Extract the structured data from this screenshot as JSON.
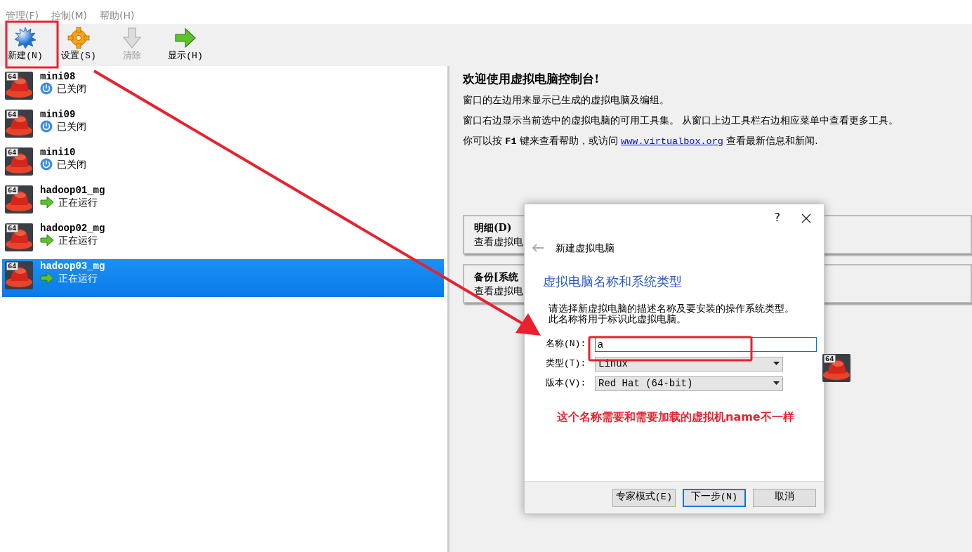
{
  "menu": [
    {
      "label": "管理(F)"
    },
    {
      "label": "控制(M)"
    },
    {
      "label": "帮助(H)"
    }
  ],
  "toolbar": [
    {
      "label": "新建(N)",
      "kind": "new",
      "disabled": false
    },
    {
      "label": "设置(S)",
      "kind": "settings",
      "disabled": false
    },
    {
      "label": "清除",
      "kind": "discard",
      "disabled": true
    },
    {
      "label": "显示(H)",
      "kind": "show",
      "disabled": false
    }
  ],
  "vms": [
    {
      "name": "mini08",
      "arch": "64",
      "status": "已关闭",
      "kind": "off",
      "selected": false
    },
    {
      "name": "mini09",
      "arch": "64",
      "status": "已关闭",
      "kind": "off",
      "selected": false
    },
    {
      "name": "mini10",
      "arch": "64",
      "status": "已关闭",
      "kind": "off",
      "selected": false
    },
    {
      "name": "hadoop01_mg",
      "arch": "64",
      "status": "正在运行",
      "kind": "running",
      "selected": false
    },
    {
      "name": "hadoop02_mg",
      "arch": "64",
      "status": "正在运行",
      "kind": "running",
      "selected": false
    },
    {
      "name": "hadoop03_mg",
      "arch": "64",
      "status": "正在运行",
      "kind": "running",
      "selected": true
    }
  ],
  "welcome": {
    "title": "欢迎使用虚拟电脑控制台!",
    "lines": [
      "窗口的左边用来显示已生成的虚拟电脑及编组。",
      "窗口右边显示当前选中的虚拟电脑的可用工具集。 从窗口上边工具栏右边相应菜单中查看更多工具。"
    ],
    "help_before": "你可以按 **F1** 键来查看帮助，或访问",
    "link": "www.virtualbox.org",
    "help_after": "查看最新信息和新闻."
  },
  "tools": [
    {
      "title": "明细(D)",
      "desc": "查看虚拟电"
    },
    {
      "title": "备份[系统",
      "desc": "查看虚拟电"
    }
  ],
  "dialog": {
    "help": "?",
    "title": "新建虚拟电脑",
    "heading": "虚拟电脑名称和系统类型",
    "intro": [
      "请选择新虚拟电脑的描述名称及要安装的操作系统类型。",
      "此名称将用于标识此虚拟电脑。"
    ],
    "fields": [
      {
        "label": "名称(N):",
        "kind": "text",
        "value": "a"
      },
      {
        "label": "类型(T):",
        "kind": "select",
        "value": "Linux"
      },
      {
        "label": "版本(V):",
        "kind": "select",
        "value": "Red Hat (64-bit)"
      }
    ],
    "os_badge": "64",
    "buttons": [
      {
        "label": "专家模式(E)",
        "default": false
      },
      {
        "label": "下一步(N)",
        "default": true
      },
      {
        "label": "取消",
        "default": false
      }
    ]
  },
  "annotation": "这个名称需要和需要加载的虚拟机name不一样"
}
